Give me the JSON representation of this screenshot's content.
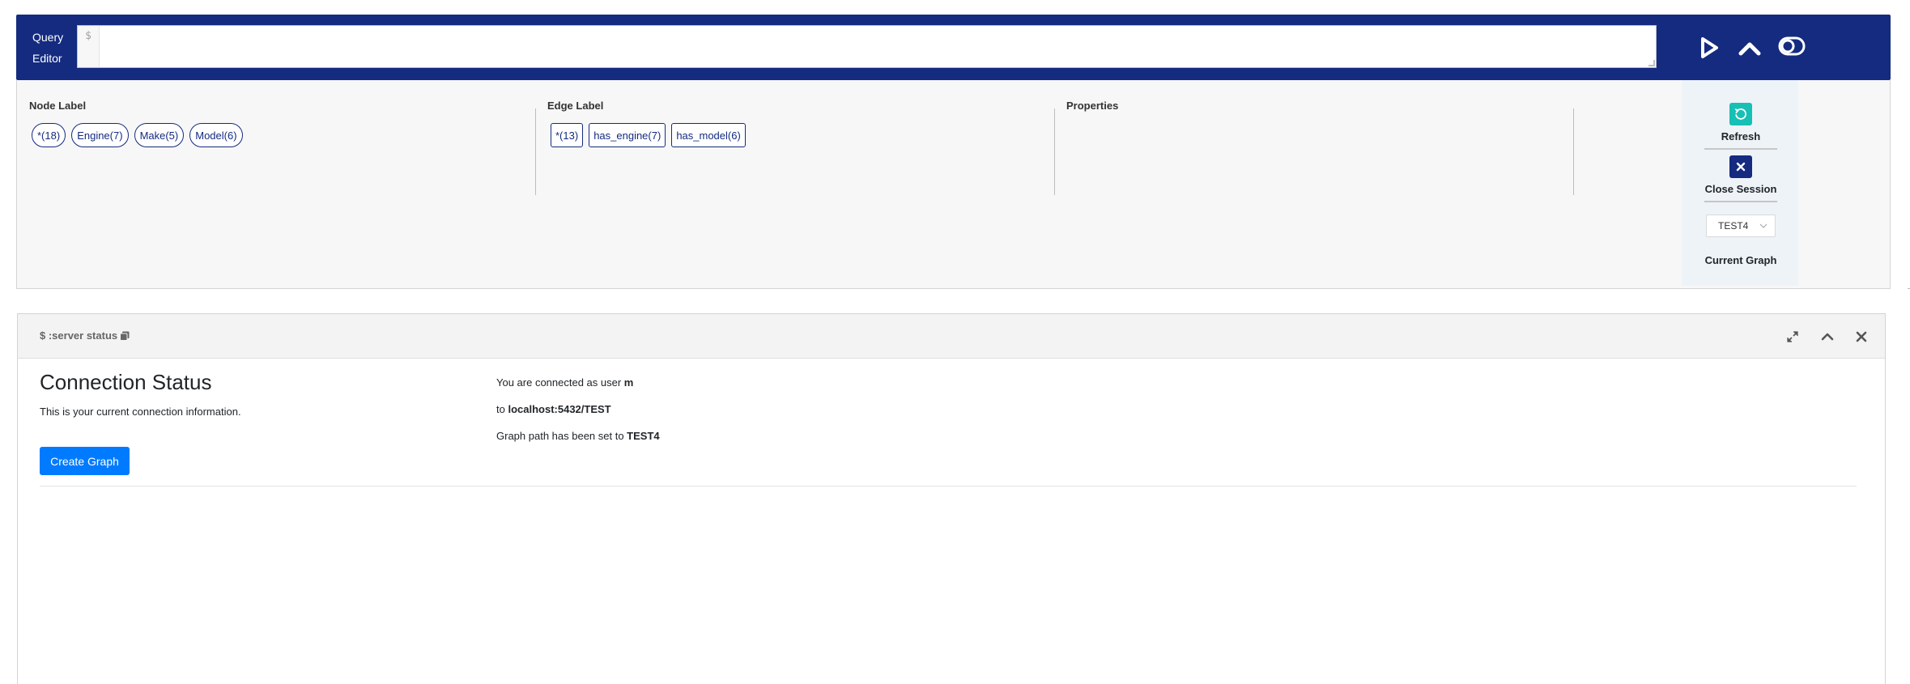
{
  "editor": {
    "title_line1": "Query",
    "title_line2": "Editor",
    "prompt": "$",
    "value": "",
    "buttons": [
      "play-icon",
      "chevron-up-icon",
      "toggle-icon"
    ]
  },
  "metadata": {
    "node_label_heading": "Node Label",
    "edge_label_heading": "Edge Label",
    "properties_heading": "Properties",
    "node_labels": [
      "*(18)",
      "Engine(7)",
      "Make(5)",
      "Model(6)"
    ],
    "edge_labels": [
      "*(13)",
      "has_engine(7)",
      "has_model(6)"
    ],
    "actions": {
      "refresh_label": "Refresh",
      "close_session_label": "Close Session",
      "current_graph_value": "TEST4",
      "current_graph_label": "Current Graph"
    }
  },
  "frame": {
    "command": "$ :server status",
    "title": "Connection Status",
    "description": "This is your current connection information.",
    "create_graph_label": "Create Graph",
    "connected_prefix": "You are connected as user ",
    "user": "m",
    "to_prefix": "to ",
    "host": "localhost:5432/TEST",
    "graph_path_prefix": "Graph path has been set to ",
    "graph_path": "TEST4"
  },
  "colors": {
    "header_navy": "#142b80",
    "refresh_teal": "#17c0b5",
    "primary_blue": "#007bff"
  }
}
